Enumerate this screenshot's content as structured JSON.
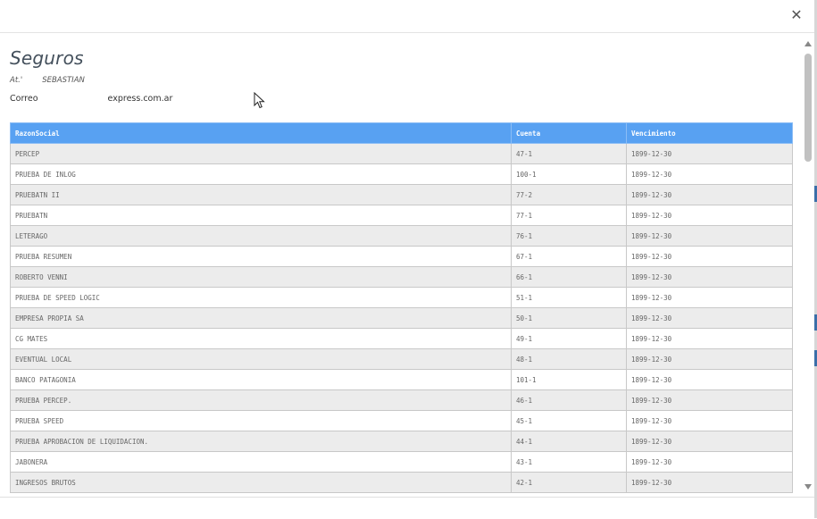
{
  "modal": {
    "close_icon": "close-icon"
  },
  "header": {
    "title": "Seguros",
    "attention_prefix": "At.'",
    "attention_name": "SEBASTIAN",
    "email_label": "Correo",
    "email_domain": "express.com.ar"
  },
  "table": {
    "columns": [
      "RazonSocial",
      "Cuenta",
      "Vencimiento"
    ],
    "rows": [
      {
        "razon": "PERCEP",
        "cuenta": "47-1",
        "vencimiento": "1899-12-30"
      },
      {
        "razon": "PRUEBA DE INLOG",
        "cuenta": "100-1",
        "vencimiento": "1899-12-30"
      },
      {
        "razon": "PRUEBATN II",
        "cuenta": "77-2",
        "vencimiento": "1899-12-30"
      },
      {
        "razon": "PRUEBATN",
        "cuenta": "77-1",
        "vencimiento": "1899-12-30"
      },
      {
        "razon": "LETERAGO",
        "cuenta": "76-1",
        "vencimiento": "1899-12-30"
      },
      {
        "razon": "PRUEBA RESUMEN",
        "cuenta": "67-1",
        "vencimiento": "1899-12-30"
      },
      {
        "razon": "ROBERTO VENNI",
        "cuenta": "66-1",
        "vencimiento": "1899-12-30"
      },
      {
        "razon": "PRUEBA DE SPEED LOGIC",
        "cuenta": "51-1",
        "vencimiento": "1899-12-30"
      },
      {
        "razon": "EMPRESA PROPIA SA",
        "cuenta": "50-1",
        "vencimiento": "1899-12-30"
      },
      {
        "razon": "CG MATES",
        "cuenta": "49-1",
        "vencimiento": "1899-12-30"
      },
      {
        "razon": "EVENTUAL LOCAL",
        "cuenta": "48-1",
        "vencimiento": "1899-12-30"
      },
      {
        "razon": "BANCO PATAGONIA",
        "cuenta": "101-1",
        "vencimiento": "1899-12-30"
      },
      {
        "razon": "PRUEBA PERCEP.",
        "cuenta": "46-1",
        "vencimiento": "1899-12-30"
      },
      {
        "razon": "PRUEBA SPEED",
        "cuenta": "45-1",
        "vencimiento": "1899-12-30"
      },
      {
        "razon": "PRUEBA APROBACION DE LIQUIDACION.",
        "cuenta": "44-1",
        "vencimiento": "1899-12-30"
      },
      {
        "razon": "JABONERA",
        "cuenta": "43-1",
        "vencimiento": "1899-12-30"
      },
      {
        "razon": "INGRESOS BRUTOS",
        "cuenta": "42-1",
        "vencimiento": "1899-12-30"
      }
    ]
  },
  "colors": {
    "header_blue": "#58a1f2",
    "row_alt": "#ececec",
    "edge_accent": "#3b6fa8"
  }
}
